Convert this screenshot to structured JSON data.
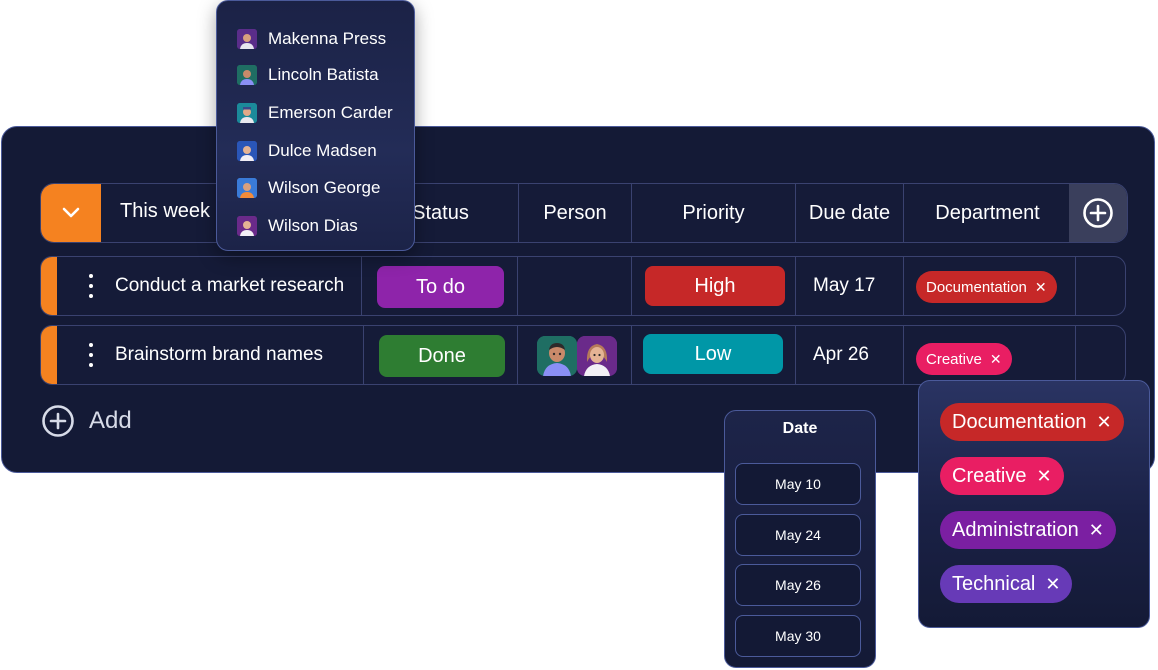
{
  "group": {
    "title": "This week"
  },
  "columns": {
    "status": "Status",
    "person": "Person",
    "priority": "Priority",
    "due_date": "Due date",
    "department": "Department"
  },
  "rows": [
    {
      "task": "Conduct a market research",
      "status": "To do",
      "priority": "High",
      "due": "May 17",
      "department": "Documentation"
    },
    {
      "task": "Brainstorm brand names",
      "status": "Done",
      "priority": "Low",
      "due": "Apr 26",
      "department": "Creative"
    }
  ],
  "add_label": "Add",
  "person_menu": [
    "Makenna Press",
    "Lincoln Batista",
    "Emerson Carder",
    "Dulce Madsen",
    "Wilson George",
    "Wilson Dias"
  ],
  "date_menu": {
    "title": "Date",
    "options": [
      "May 10",
      "May 24",
      "May 26",
      "May 30"
    ]
  },
  "dept_menu": {
    "close_glyph": "✕",
    "options": [
      "Documentation",
      "Creative",
      "Administration",
      "Technical"
    ]
  },
  "colors": {
    "board_bg": "#141a36",
    "accent_orange": "#f58220",
    "status_todo": "#8e24aa",
    "status_done": "#2e7d32",
    "priority_high": "#c62828",
    "priority_low": "#0097a7",
    "dept_documentation": "#c62828",
    "dept_creative": "#e91e63",
    "dept_administration": "#7b1fa2",
    "dept_technical": "#673ab7"
  },
  "icons": {
    "collapse": "chevron-down-icon",
    "add_column": "plus-circle-icon",
    "add_row": "plus-circle-icon",
    "row_menu": "kebab-menu-icon"
  }
}
